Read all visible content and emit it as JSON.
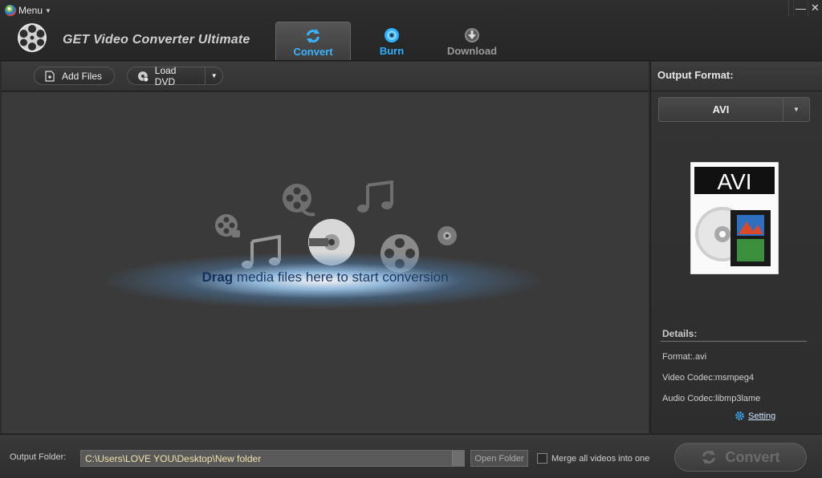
{
  "window": {
    "menu_label": "Menu",
    "app_title": "GET Video Converter Ultimate",
    "minimize": "—",
    "close": "✕"
  },
  "tabs": [
    {
      "label": "Convert",
      "icon": "refresh-icon",
      "active": true,
      "color": "#3ab4ff"
    },
    {
      "label": "Burn",
      "icon": "disc-icon",
      "active": false,
      "color": "#2ab0ff"
    },
    {
      "label": "Download",
      "icon": "download-icon",
      "active": false,
      "color": "#9a9a9a"
    }
  ],
  "toolbar": {
    "add_files_label": "Add Files",
    "load_dvd_label": "Load DVD"
  },
  "drop_area": {
    "bold_word": "Drag",
    "message": " media files here to start conversion"
  },
  "output_format": {
    "title": "Output Format:",
    "selected": "AVI",
    "icon_label": "AVI"
  },
  "details": {
    "title": "Details:",
    "format": "Format:.avi",
    "video_codec": "Video Codec:msmpeg4",
    "audio_codec": "Audio Codec:libmp3lame",
    "setting_label": "Setting"
  },
  "bottom": {
    "output_folder_label": "Output Folder:",
    "output_folder_path": "C:\\Users\\LOVE YOU\\Desktop\\New folder",
    "open_folder_label": "Open Folder",
    "merge_label": "Merge all videos into one",
    "merge_checked": false,
    "convert_label": "Convert"
  },
  "colors": {
    "accent": "#3ab4ff",
    "path_text": "#f0e2a8",
    "drop_text": "#1d3a66"
  }
}
